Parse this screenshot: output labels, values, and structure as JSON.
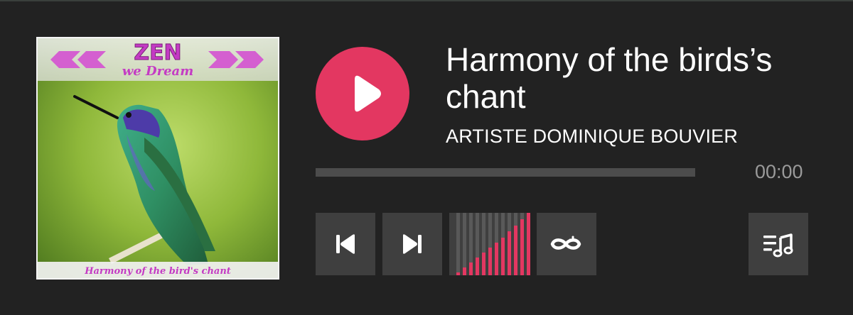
{
  "player": {
    "track_title": "Harmony of the birds’s chant",
    "artist": "ARTISTE DOMINIQUE BOUVIER",
    "time_display": "00:00",
    "progress": 0,
    "accent_color": "#e33761",
    "background_color": "#222222",
    "button_color": "#3f3f3f"
  },
  "album_art": {
    "logo_word": "ZEN",
    "logo_subtitle": "we Dream",
    "caption": "Harmony of the bird's chant"
  },
  "controls": {
    "play_icon": "play-icon",
    "prev_icon": "skip-previous-icon",
    "next_icon": "skip-next-icon",
    "repeat_icon": "infinity-loop-icon",
    "playlist_icon": "playlist-music-icon"
  },
  "volume": {
    "bars": 12,
    "levels": [
      0.05,
      0.12,
      0.2,
      0.28,
      0.36,
      0.44,
      0.52,
      0.6,
      0.7,
      0.8,
      0.9,
      1.0
    ]
  }
}
